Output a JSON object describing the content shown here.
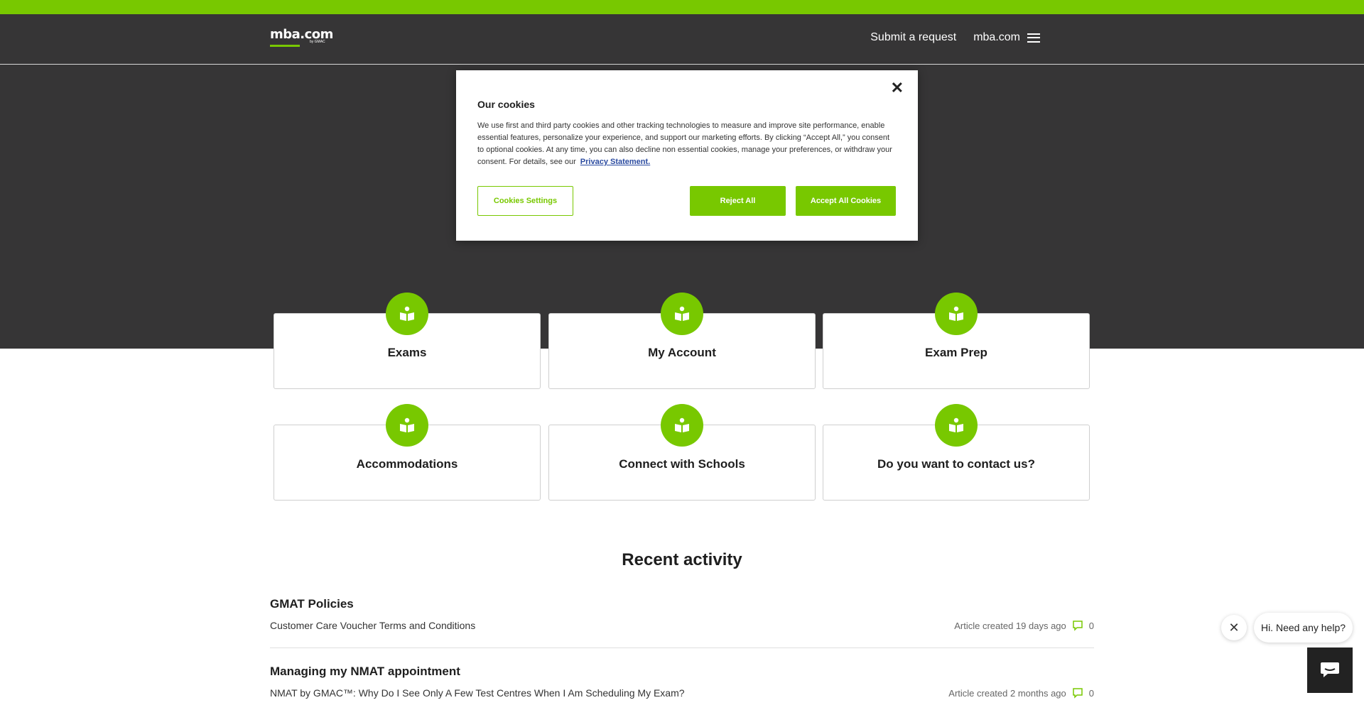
{
  "header": {
    "logo_text": "mba.com",
    "logo_sub": "by GMAC",
    "nav": {
      "submit_request": "Submit a request",
      "site_link": "mba.com"
    }
  },
  "categories": [
    {
      "label": "Exams",
      "icon": "book-icon"
    },
    {
      "label": "My Account",
      "icon": "book-icon"
    },
    {
      "label": "Exam Prep",
      "icon": "book-icon"
    },
    {
      "label": "Accommodations",
      "icon": "book-icon"
    },
    {
      "label": "Connect with Schools",
      "icon": "book-icon"
    },
    {
      "label": "Do you want to contact us?",
      "icon": "book-icon"
    }
  ],
  "recent_activity": {
    "title": "Recent activity",
    "items": [
      {
        "section": "GMAT Policies",
        "article": "Customer Care Voucher Terms and Conditions",
        "meta": "Article created 19 days ago",
        "comments": "0"
      },
      {
        "section": "Managing my NMAT appointment",
        "article": "NMAT by GMAC™: Why Do I See Only A Few Test Centres When I Am Scheduling My Exam?",
        "meta": "Article created 2 months ago",
        "comments": "0"
      }
    ]
  },
  "cookie_modal": {
    "title": "Our cookies",
    "text": "We use first and third party cookies and other tracking technologies to measure and improve site performance, enable essential features, personalize your experience, and support our marketing efforts. By clicking “Accept All,” you consent to optional cookies. At any time, you can also decline non essential cookies, manage your preferences, or withdraw your consent. For details, see our",
    "privacy_link": "Privacy Statement.",
    "buttons": {
      "settings": "Cookies Settings",
      "reject": "Reject All",
      "accept": "Accept All Cookies"
    }
  },
  "chat": {
    "greeting": "Hi. Need any help?"
  },
  "colors": {
    "brand_green": "#78c800",
    "header_dark": "#363536"
  }
}
